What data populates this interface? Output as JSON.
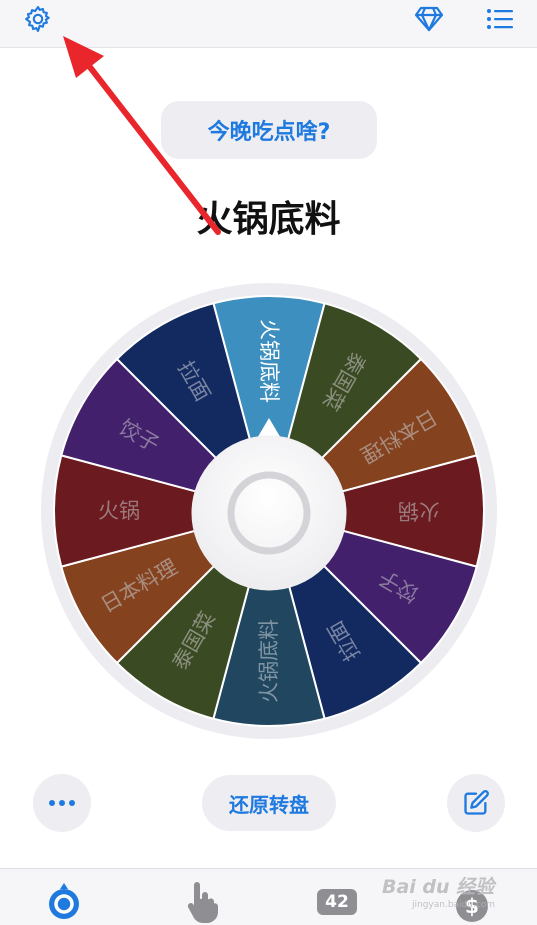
{
  "topbar": {
    "settings_icon": "gear-icon",
    "vip_icon": "diamond-icon",
    "list_icon": "list-icon"
  },
  "question": {
    "label": "今晚吃点啥?"
  },
  "result": {
    "title": "火锅底料"
  },
  "wheel": {
    "segments": [
      {
        "label": "火锅底料",
        "color": "#3d8fbf",
        "text_color": "#ffffff"
      },
      {
        "label": "泰国菜",
        "color": "#3a4a22",
        "text_color": "#8a8f7e"
      },
      {
        "label": "日本料理",
        "color": "#85421f",
        "text_color": "#a98e80"
      },
      {
        "label": "火锅",
        "color": "#6b1a1f",
        "text_color": "#9a7a7c"
      },
      {
        "label": "饺子",
        "color": "#42206b",
        "text_color": "#8a7aa0"
      },
      {
        "label": "拉面",
        "color": "#122a60",
        "text_color": "#7a85a3"
      },
      {
        "label": "火锅底料",
        "color": "#204660",
        "text_color": "#7f94a3"
      },
      {
        "label": "泰国菜",
        "color": "#3a4a22",
        "text_color": "#8a8f7e"
      },
      {
        "label": "日本料理",
        "color": "#85421f",
        "text_color": "#a98e80"
      },
      {
        "label": "火锅",
        "color": "#6b1a1f",
        "text_color": "#9a7a7c"
      },
      {
        "label": "饺子",
        "color": "#42206b",
        "text_color": "#8a7aa0"
      },
      {
        "label": "拉面",
        "color": "#122a60",
        "text_color": "#7a85a3"
      }
    ]
  },
  "controls": {
    "more_icon": "ellipsis-icon",
    "reset_label": "还原转盘",
    "edit_icon": "edit-icon"
  },
  "tabbar": {
    "tab1_icon": "wheel-icon",
    "tab2_icon": "hand-pointer-icon",
    "tab3_badge": "42",
    "tab4_icon": "dollar-icon"
  },
  "watermark": {
    "text": "Bai du 经验",
    "sub": "jingyan.baidu.com"
  },
  "colors": {
    "accent": "#1f7ae0",
    "annotation_red": "#e8262b"
  }
}
